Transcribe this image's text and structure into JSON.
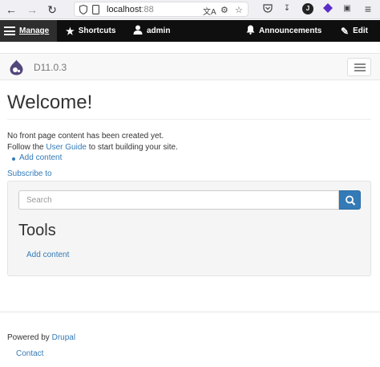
{
  "browser": {
    "url_host": "localhost",
    "url_port": ":88",
    "back_icon": "arrow-left-icon",
    "forward_icon": "arrow-right-icon",
    "reload_icon": "reload-icon",
    "extension_initial": "J"
  },
  "toolbar": {
    "manage_label": "Manage",
    "shortcuts_label": "Shortcuts",
    "user_label": "admin",
    "announcements_label": "Announcements",
    "edit_label": "Edit",
    "background": "#0f0f0f"
  },
  "site": {
    "name": "D11.0.3",
    "logo_color": "#53467c"
  },
  "main": {
    "title": "Welcome!",
    "no_content_text": "No front page content has been created yet.",
    "follow_prefix": "Follow the ",
    "user_guide_link": "User Guide",
    "follow_suffix": " to start building your site.",
    "add_content_link": "Add content",
    "subscribe_link": "Subscribe to"
  },
  "sidebar": {
    "search_placeholder": "Search",
    "tools_title": "Tools",
    "tools_link": "Add content",
    "accent": "#337ab7"
  },
  "footer": {
    "powered_prefix": "Powered by ",
    "powered_link": "Drupal",
    "contact_link": "Contact"
  }
}
